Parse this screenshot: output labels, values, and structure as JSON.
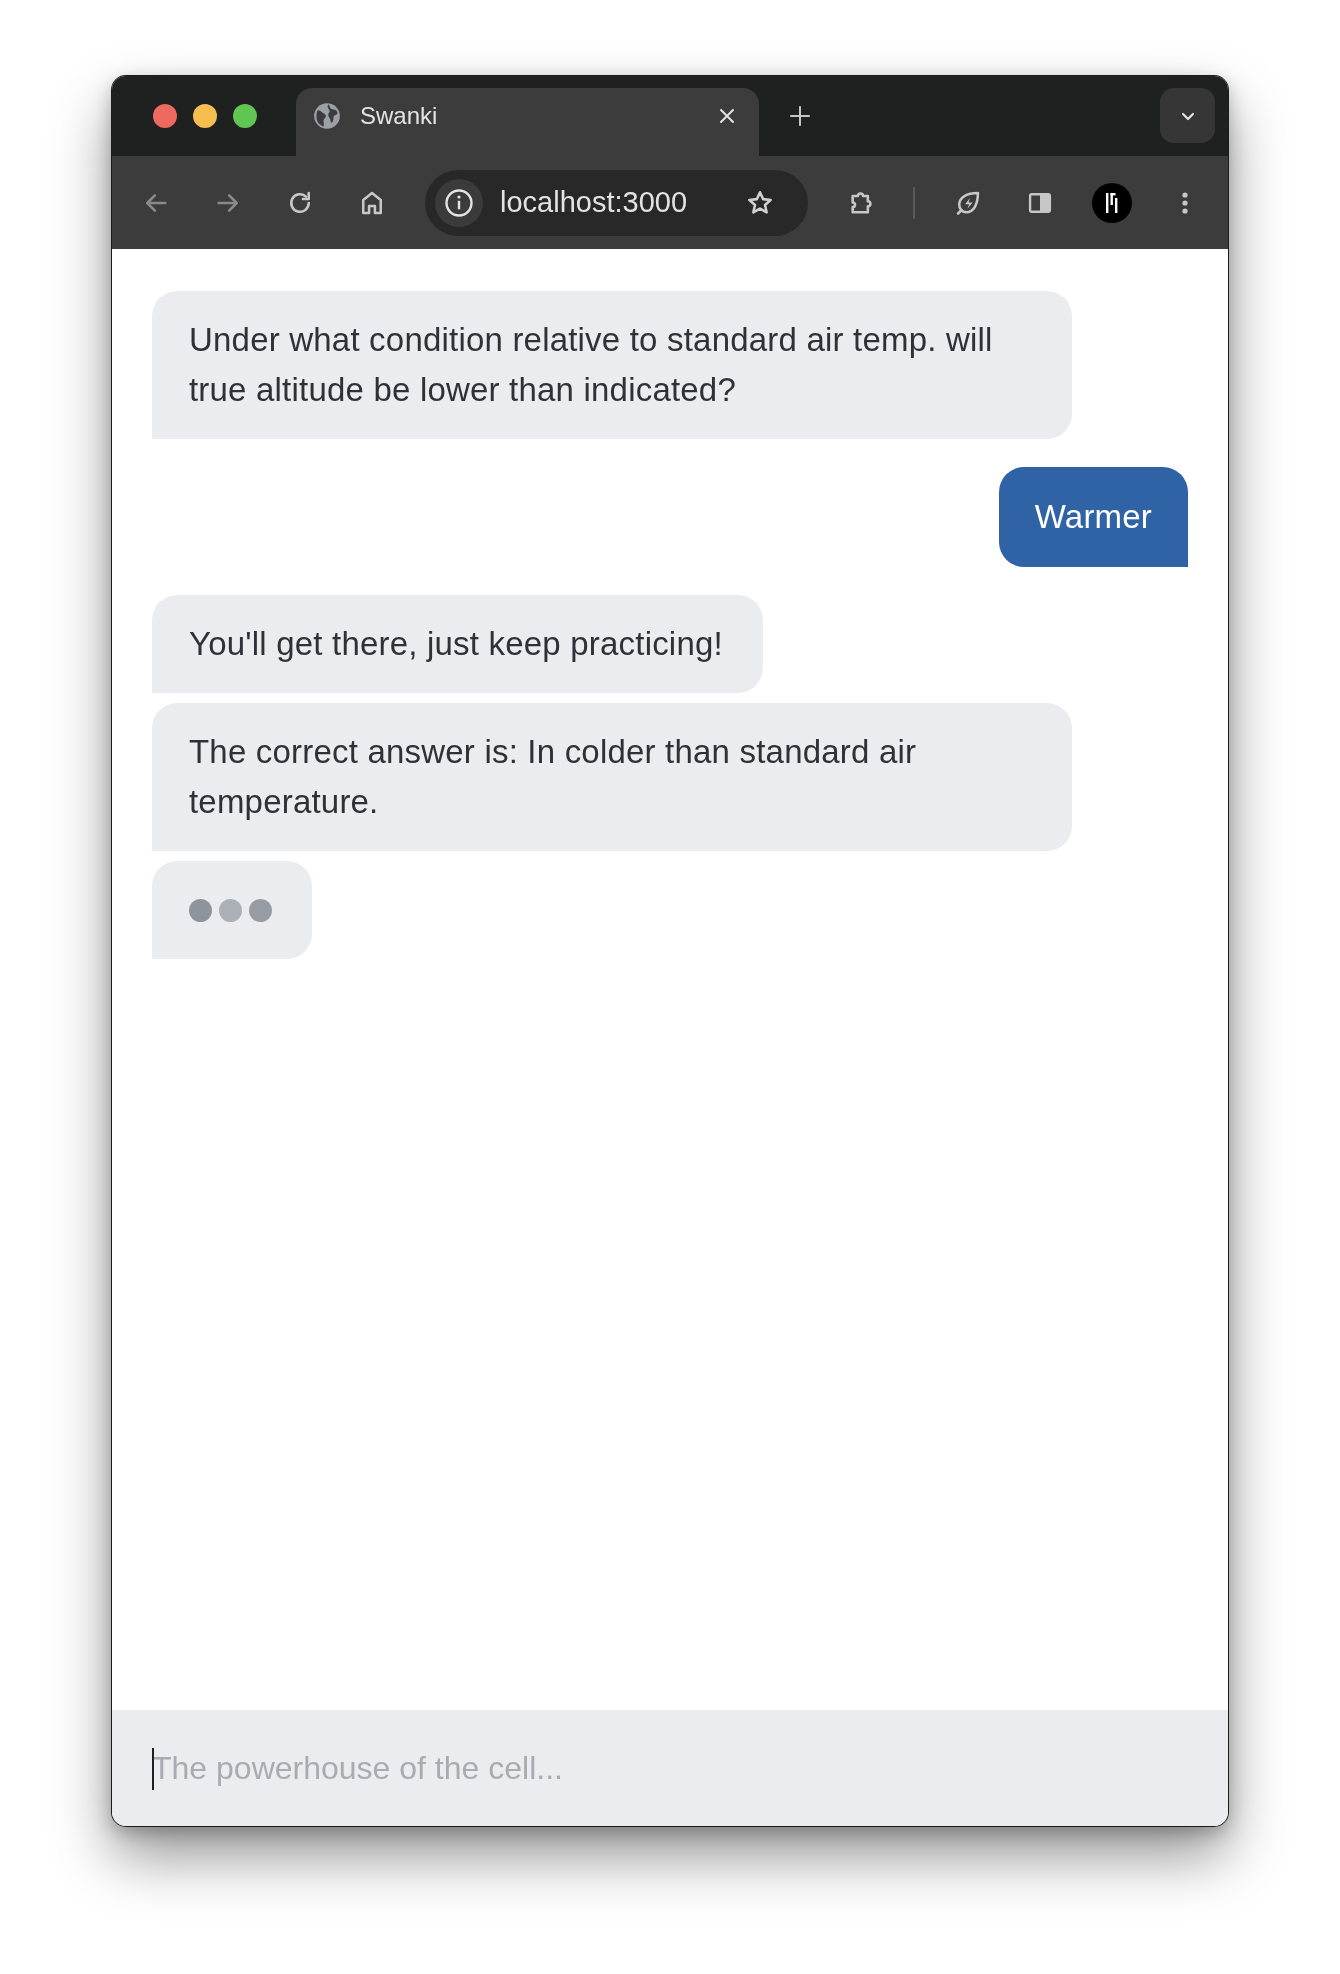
{
  "browser": {
    "tabs": [
      {
        "title": "Swanki",
        "selected": true
      }
    ],
    "nav": [
      {
        "kind": "back",
        "disabled": true
      },
      {
        "kind": "forward",
        "disabled": true
      },
      {
        "kind": "reload",
        "disabled": false
      },
      {
        "kind": "home",
        "disabled": false
      }
    ],
    "address": "localhost:3000"
  },
  "messages": [
    {
      "kind": "text",
      "outgoing": false,
      "text": "Under what condition relative to standard air temp. will true altitude be lower than indicated?"
    },
    {
      "kind": "text",
      "outgoing": true,
      "text": "Warmer"
    },
    {
      "kind": "text",
      "outgoing": false,
      "text": "You'll get there, just keep practicing!"
    },
    {
      "kind": "text",
      "outgoing": false,
      "text": "The correct answer is: In colder than standard air temperature."
    },
    {
      "kind": "typing",
      "outgoing": false,
      "dots": [
        {
          "color": "#8e949c"
        },
        {
          "color": "#abafb6"
        },
        {
          "color": "#979ca4"
        }
      ]
    }
  ],
  "composer": {
    "placeholder": "The powerhouse of the cell..."
  }
}
